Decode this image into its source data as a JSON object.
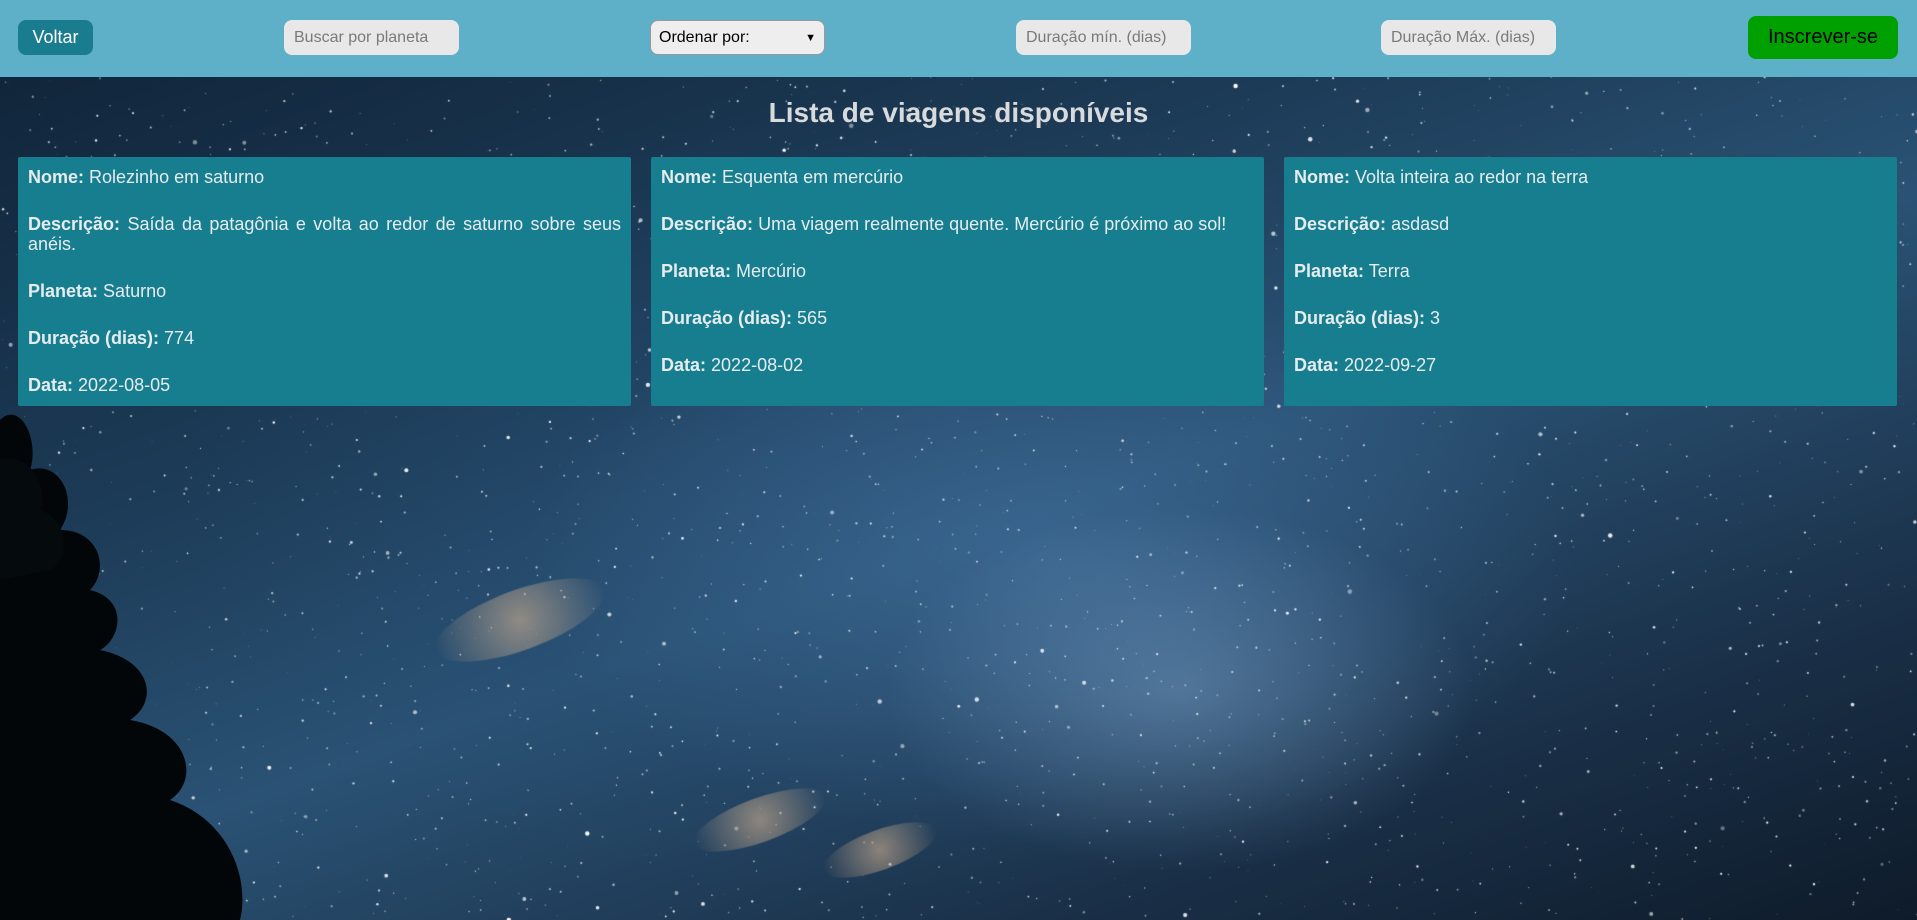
{
  "header": {
    "back_label": "Voltar",
    "search_placeholder": "Buscar por planeta",
    "sort_label": "Ordenar por:",
    "min_duration_placeholder": "Duração mín. (dias)",
    "max_duration_placeholder": "Duração Máx. (dias)",
    "signup_label": "Inscrever-se"
  },
  "main": {
    "title": "Lista de viagens disponíveis",
    "field_labels": {
      "name": "Nome:",
      "description": "Descrição:",
      "planet": "Planeta:",
      "duration": "Duração (dias):",
      "date": "Data:"
    },
    "trips": [
      {
        "name": "Rolezinho em saturno",
        "description": "Saída da patagônia e volta ao redor de saturno sobre seus anéis.",
        "planet": "Saturno",
        "duration": "774",
        "date": "2022-08-05"
      },
      {
        "name": "Esquenta em mercúrio",
        "description": "Uma viagem realmente quente. Mercúrio é próximo ao sol!",
        "planet": "Mercúrio",
        "duration": "565",
        "date": "2022-08-02"
      },
      {
        "name": "Volta inteira ao redor na terra",
        "description": "asdasd",
        "planet": "Terra",
        "duration": "3",
        "date": "2022-09-27"
      }
    ]
  },
  "colors": {
    "header_bg": "#5db0c8",
    "card_bg": "#177e90",
    "back_button_bg": "#1a7d8f",
    "signup_button_bg": "#00a000"
  }
}
